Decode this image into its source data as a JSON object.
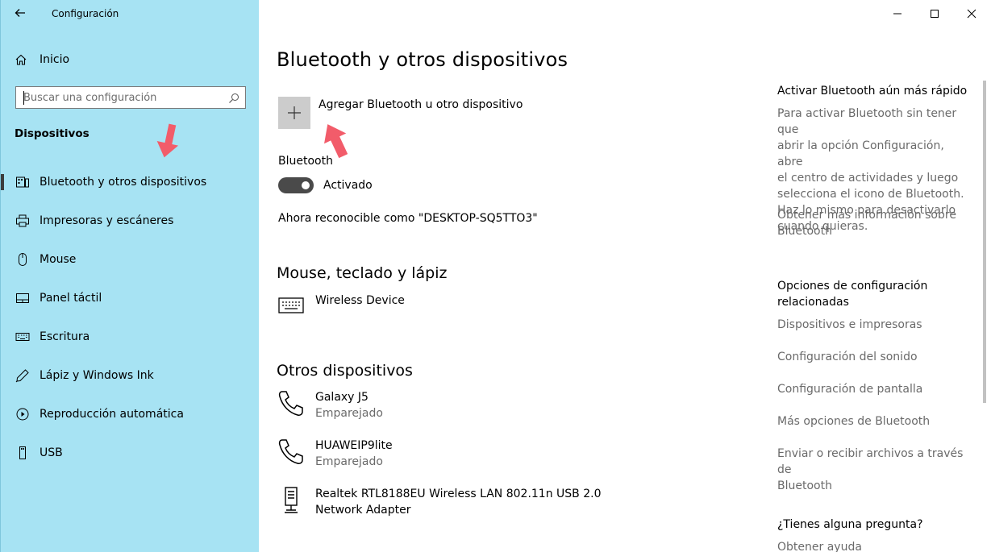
{
  "window": {
    "title": "Configuración",
    "minimize": "—",
    "maximize": "☐",
    "close": "✕"
  },
  "sidebar": {
    "home_label": "Inicio",
    "search_placeholder": "Buscar una configuración",
    "section_title": "Dispositivos",
    "items": [
      {
        "label": "Bluetooth y otros dispositivos",
        "icon": "bluetooth-devices-icon"
      },
      {
        "label": "Impresoras y escáneres",
        "icon": "printer-icon"
      },
      {
        "label": "Mouse",
        "icon": "mouse-icon"
      },
      {
        "label": "Panel táctil",
        "icon": "touchpad-icon"
      },
      {
        "label": "Escritura",
        "icon": "keyboard-icon"
      },
      {
        "label": "Lápiz y Windows Ink",
        "icon": "pen-icon"
      },
      {
        "label": "Reproducción automática",
        "icon": "autoplay-icon"
      },
      {
        "label": "USB",
        "icon": "usb-icon"
      }
    ]
  },
  "main": {
    "title": "Bluetooth y otros dispositivos",
    "add_device_label": "Agregar Bluetooth u otro dispositivo",
    "bluetooth_label": "Bluetooth",
    "toggle_state": "Activado",
    "discoverable_text": "Ahora reconocible como \"DESKTOP-SQ5TTO3\"",
    "mouse_section_title": "Mouse, teclado y lápiz",
    "mouse_devices": [
      {
        "name": "Wireless Device",
        "status": ""
      }
    ],
    "other_section_title": "Otros dispositivos",
    "other_devices": [
      {
        "name": "Galaxy J5",
        "status": "Emparejado"
      },
      {
        "name": "HUAWEIP9lite",
        "status": "Emparejado"
      },
      {
        "name": "Realtek RTL8188EU Wireless LAN 802.11n USB 2.0",
        "status": "Network Adapter"
      }
    ]
  },
  "right": {
    "fast_title": "Activar Bluetooth aún más rápido",
    "fast_text": [
      "Para activar Bluetooth sin tener que",
      "abrir la opción Configuración, abre",
      "el centro de actividades y luego",
      "selecciona el icono de Bluetooth.",
      "Haz lo mismo para desactivarlo",
      "cuando quieras."
    ],
    "more_info": [
      "Obtener más información sobre",
      "Bluetooth"
    ],
    "related_title": [
      "Opciones de configuración",
      "relacionadas"
    ],
    "related_links": [
      "Dispositivos e impresoras",
      "Configuración del sonido",
      "Configuración de pantalla",
      "Más opciones de Bluetooth"
    ],
    "send_files": [
      "Enviar o recibir archivos a través de",
      "Bluetooth"
    ],
    "question_title": "¿Tienes alguna pregunta?",
    "help_link": "Obtener ayuda"
  },
  "colors": {
    "sidebar_bg": "#a7e3f3",
    "annotation_arrow": "#f25c6a"
  }
}
